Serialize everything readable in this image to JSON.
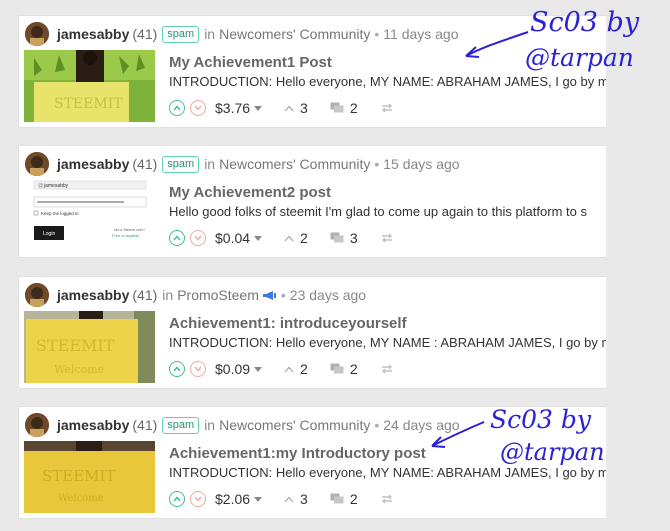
{
  "posts": [
    {
      "author": "jamesabby",
      "reputation": "(41)",
      "tag": "spam",
      "in_label": "in",
      "community": "Newcomers' Community",
      "time": "11 days ago",
      "title": "My Achievement1 Post",
      "summary": "INTRODUCTION: Hello everyone, MY NAME: ABRAHAM JAMES, I go by my s",
      "payout": "$3.76",
      "votes": "3",
      "comments": "2",
      "thumb_icon": "person-holding-steemit-sign-green-photo"
    },
    {
      "author": "jamesabby",
      "reputation": "(41)",
      "tag": "spam",
      "in_label": "in",
      "community": "Newcomers' Community",
      "time": "15 days ago",
      "title": "My Achievement2 post",
      "summary": "Hello good folks of steemit I'm glad to come up again to this platform to s",
      "payout": "$0.04",
      "votes": "2",
      "comments": "3",
      "thumb_icon": "login-form-screenshot",
      "thumb_text": {
        "username": "jamesabby",
        "keep_logged_in": "Keep me logged in",
        "login_button": "Login",
        "new_user": "Not a Steemit user?",
        "free_register": "Free to register"
      }
    },
    {
      "author": "jamesabby",
      "reputation": "(41)",
      "tag": "",
      "in_label": "in",
      "community": "PromoSteem",
      "community_icon": "megaphone-icon",
      "time": "23 days ago",
      "title": "Achievement1: introduceyourself",
      "summary": "INTRODUCTION: Hello everyone, MY NAME : ABRAHAM JAMES, I go by my s",
      "payout": "$0.09",
      "votes": "2",
      "comments": "2",
      "thumb_icon": "person-holding-steemit-sign-yellow-photo"
    },
    {
      "author": "jamesabby",
      "reputation": "(41)",
      "tag": "spam",
      "in_label": "in",
      "community": "Newcomers' Community",
      "time": "24 days ago",
      "title": "Achievement1:my Introductory post",
      "summary": "INTRODUCTION: Hello everyone, MY NAME: ABRAHAM JAMES, I go by my s",
      "payout": "$2.06",
      "votes": "3",
      "comments": "2",
      "thumb_icon": "person-holding-steemit-sign-yellow-photo"
    }
  ],
  "annotations": [
    {
      "line1": "Sc03 by",
      "line2": "@tarpan",
      "color": "#2b22d6"
    },
    {
      "line1": "Sc03 by",
      "line2": "@tarpan",
      "color": "#2b22d6"
    }
  ],
  "colors": {
    "upvote": "#3fbf96",
    "downvote": "#f0a9a0",
    "spam_tag": "#5fd0b0",
    "annotation": "#2b22d6"
  }
}
